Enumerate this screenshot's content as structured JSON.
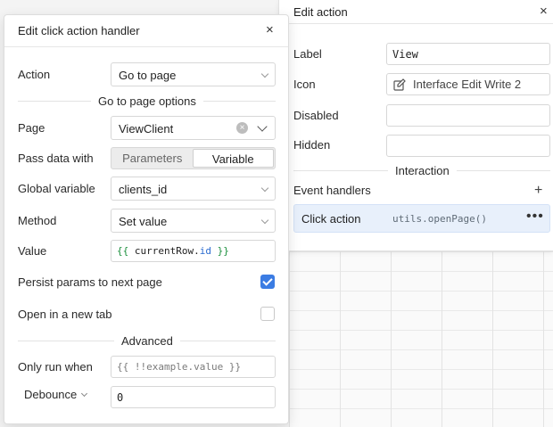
{
  "edit_action": {
    "title": "Edit action",
    "close_glyph": "×",
    "label_label": "Label",
    "label_value": "View",
    "icon_label": "Icon",
    "icon_value": "Interface Edit Write 2",
    "icon_name": "pencil-icon",
    "disabled_label": "Disabled",
    "disabled_value": "",
    "hidden_label": "Hidden",
    "hidden_value": "",
    "interaction_title": "Interaction",
    "event_handlers_label": "Event handlers",
    "add_glyph": "+",
    "handler": {
      "name": "Click action",
      "code": "utils.openPage()",
      "menu_glyph": "•••"
    }
  },
  "click_handler": {
    "title": "Edit click action handler",
    "close_glyph": "×",
    "action_label": "Action",
    "action_value": "Go to page",
    "options_title": "Go to page options",
    "page_label": "Page",
    "page_value": "ViewClient",
    "clear_glyph": "×",
    "pass_data_label": "Pass data with",
    "pass_data_options": [
      "Parameters",
      "Variable"
    ],
    "pass_data_selected": "Variable",
    "global_variable_label": "Global variable",
    "global_variable_value": "clients_id",
    "method_label": "Method",
    "method_value": "Set value",
    "value_label": "Value",
    "value_open": "{{",
    "value_expr_object": "currentRow",
    "value_expr_dot": ".",
    "value_expr_prop": "id",
    "value_close": "}}",
    "persist_label": "Persist params to next page",
    "persist_checked": true,
    "new_tab_label": "Open in a new tab",
    "new_tab_checked": false,
    "advanced_title": "Advanced",
    "only_run_label": "Only run when",
    "only_run_placeholder": "{{ !!example.value }}",
    "debounce_label": "Debounce",
    "debounce_value": "0"
  },
  "colors": {
    "accent": "#3b7ce3",
    "handler_bg": "#e8f0fb",
    "code_green": "#1a8f3c",
    "code_blue": "#2a6bd0"
  }
}
